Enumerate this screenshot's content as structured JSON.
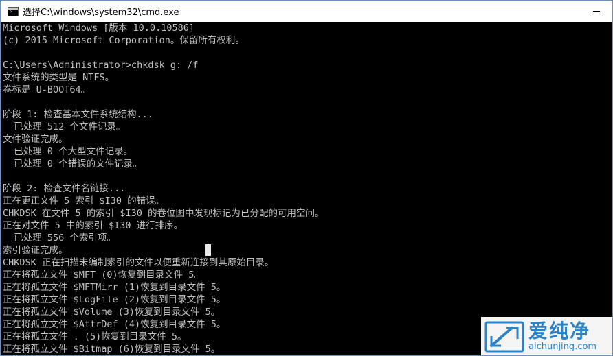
{
  "window": {
    "title": "选择C:\\windows\\system32\\cmd.exe",
    "minimize_glyph": "—"
  },
  "console": {
    "lines": [
      "Microsoft Windows [版本 10.0.10586]",
      "(c) 2015 Microsoft Corporation。保留所有权利。",
      "",
      "C:\\Users\\Administrator>chkdsk g: /f",
      "文件系统的类型是 NTFS。",
      "卷标是 U-BOOT64。",
      "",
      "阶段 1: 检查基本文件系统结构...",
      "  已处理 512 个文件记录。",
      "文件验证完成。",
      "  已处理 0 个大型文件记录。",
      "  已处理 0 个错误的文件记录。",
      "",
      "阶段 2: 检查文件名链接...",
      "正在更正文件 5 索引 $I30 的错误。",
      "CHKDSK 在文件 5 的索引 $I30 的卷位图中发现标记为已分配的可用空间。",
      "正在对文件 5 中的索引 $I30 进行排序。",
      "  已处理 556 个索引项。",
      "索引验证完成。",
      "CHKDSK 正在扫描未编制索引的文件以便重新连接到其原始目录。",
      "正在将孤立文件 $MFT (0)恢复到目录文件 5。",
      "正在将孤立文件 $MFTMirr (1)恢复到目录文件 5。",
      "正在将孤立文件 $LogFile (2)恢复到目录文件 5。",
      "正在将孤立文件 $Volume (3)恢复到目录文件 5。",
      "正在将孤立文件 $AttrDef (4)恢复到目录文件 5。",
      "正在将孤立文件 . (5)恢复到目录文件 5。",
      "正在将孤立文件 $Bitmap (6)恢复到目录文件 5。"
    ]
  },
  "watermark": {
    "brand": "爱纯净",
    "url": "aichunjing.com"
  },
  "colors": {
    "console_bg": "#000000",
    "console_text": "#c0c0c0",
    "titlebar_bg": "#ffffff",
    "watermark_blue": "#2a83c8"
  }
}
